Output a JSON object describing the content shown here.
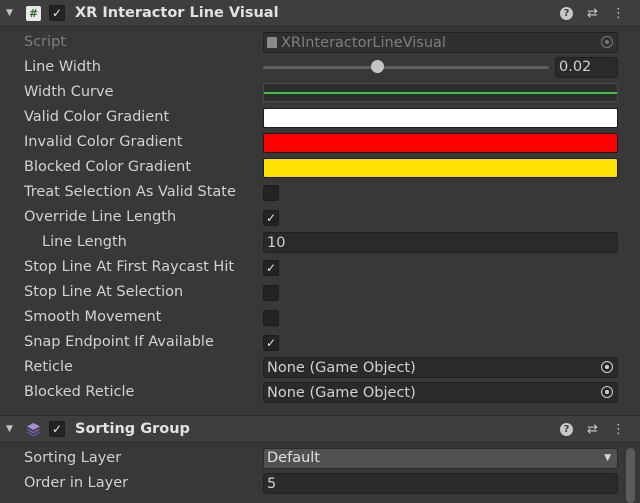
{
  "xr_component": {
    "title": "XR Interactor Line Visual",
    "enabled": "✓",
    "fields": {
      "script_label": "Script",
      "script_value": "XRInteractorLineVisual",
      "line_width_label": "Line Width",
      "line_width_value": "0.02",
      "line_width_slider_fraction": 0.4,
      "width_curve_label": "Width Curve",
      "valid_gradient_label": "Valid Color Gradient",
      "valid_gradient_color": "#ffffff",
      "invalid_gradient_label": "Invalid Color Gradient",
      "invalid_gradient_color": "#ff0000",
      "blocked_gradient_label": "Blocked Color Gradient",
      "blocked_gradient_color": "#ffe100",
      "treat_selection_label": "Treat Selection As Valid State",
      "treat_selection_checked": "",
      "override_length_label": "Override Line Length",
      "override_length_checked": "✓",
      "line_length_label": "Line Length",
      "line_length_value": "10",
      "stop_raycast_label": "Stop Line At First Raycast Hit",
      "stop_raycast_checked": "✓",
      "stop_selection_label": "Stop Line At Selection",
      "stop_selection_checked": "",
      "smooth_movement_label": "Smooth Movement",
      "smooth_movement_checked": "",
      "snap_endpoint_label": "Snap Endpoint If Available",
      "snap_endpoint_checked": "✓",
      "reticle_label": "Reticle",
      "reticle_value": "None (Game Object)",
      "blocked_reticle_label": "Blocked Reticle",
      "blocked_reticle_value": "None (Game Object)"
    }
  },
  "sorting_component": {
    "title": "Sorting Group",
    "enabled": "✓",
    "fields": {
      "sorting_layer_label": "Sorting Layer",
      "sorting_layer_value": "Default",
      "order_label": "Order in Layer",
      "order_value": "5"
    }
  },
  "icons": {
    "foldout": "▼",
    "help": "?",
    "presets": "⇄",
    "menu": "⋮",
    "dropdown": "▼",
    "script": "#"
  },
  "colors": {
    "curve_line": "#41c241"
  }
}
